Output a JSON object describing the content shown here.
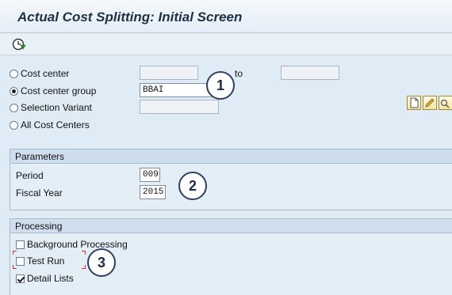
{
  "window": {
    "title": "Actual Cost Splitting: Initial Screen"
  },
  "toolbar": {
    "execute_icon": "execute-clock-icon"
  },
  "selection": {
    "cost_center_label": "Cost center",
    "to_label": "to",
    "cost_center_from": "",
    "cost_center_to": "",
    "cost_center_group_label": "Cost center group",
    "cost_center_group_value": "BBAI",
    "selection_variant_label": "Selection Variant",
    "selection_variant_value": "",
    "all_cost_centers_label": "All Cost Centers",
    "selected": "Cost center group",
    "variant_icons": [
      "create-icon",
      "change-icon",
      "display-icon"
    ]
  },
  "parameters": {
    "header": "Parameters",
    "period_label": "Period",
    "period_value": "009",
    "fiscal_year_label": "Fiscal Year",
    "fiscal_year_value": "2015"
  },
  "processing": {
    "header": "Processing",
    "background_label": "Background Processing",
    "background_checked": false,
    "test_run_label": "Test Run",
    "test_run_checked": false,
    "detail_lists_label": "Detail Lists",
    "detail_lists_checked": true
  },
  "callouts": [
    "1",
    "2",
    "3"
  ],
  "colors": {
    "callout_border": "#2d3f63",
    "focus_marker": "#e03030"
  }
}
